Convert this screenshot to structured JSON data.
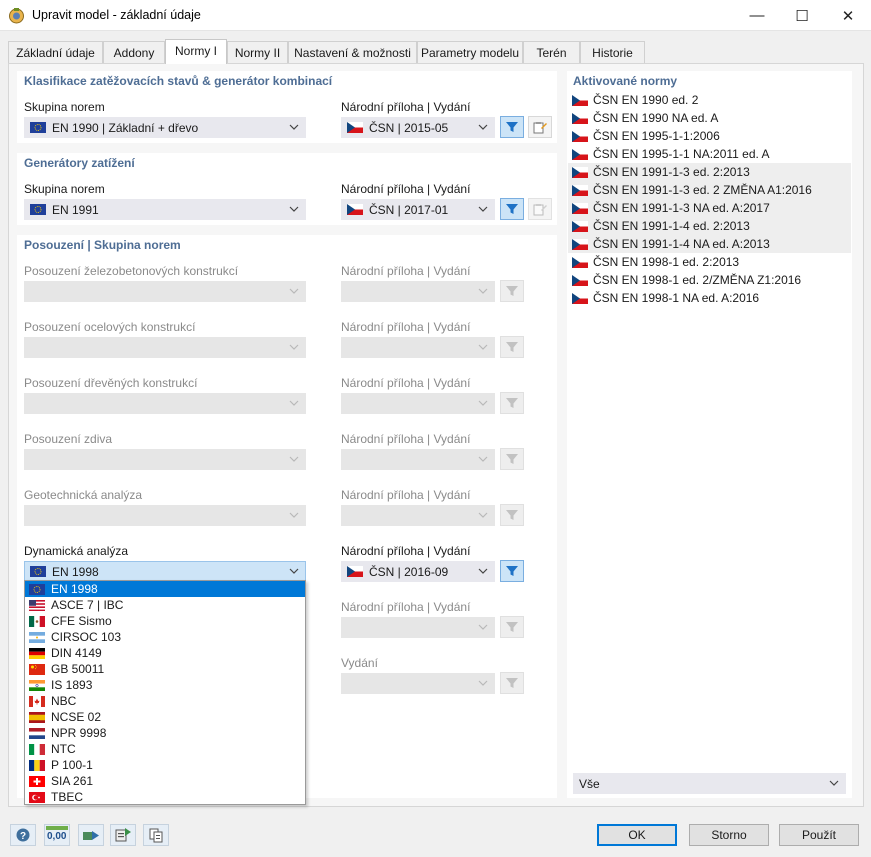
{
  "window": {
    "title": "Upravit model - základní údaje",
    "minimize_glyph": "—",
    "maximize_glyph": "☐",
    "close_glyph": "✕"
  },
  "tabs": [
    {
      "label": "Základní údaje",
      "active": false
    },
    {
      "label": "Addony",
      "active": false
    },
    {
      "label": "Normy I",
      "active": true
    },
    {
      "label": "Normy II",
      "active": false
    },
    {
      "label": "Nastavení & možnosti",
      "active": false
    },
    {
      "label": "Parametry modelu",
      "active": false
    },
    {
      "label": "Terén",
      "active": false
    },
    {
      "label": "Historie",
      "active": false
    }
  ],
  "classification": {
    "title": "Klasifikace zatěžovacích stavů & generátor kombinací",
    "group_label": "Skupina norem",
    "group_value": "EN 1990 | Základní + dřevo",
    "annex_label": "Národní příloha | Vydání",
    "annex_value": "ČSN | 2015-05"
  },
  "generators": {
    "title": "Generátory zatížení",
    "group_label": "Skupina norem",
    "group_value": "EN 1991",
    "annex_label": "Národní příloha | Vydání",
    "annex_value": "ČSN | 2017-01"
  },
  "design": {
    "title": "Posouzení | Skupina norem",
    "rows": [
      {
        "label": "Posouzení železobetonových konstrukcí",
        "annex_label": "Národní příloha | Vydání"
      },
      {
        "label": "Posouzení ocelových konstrukcí",
        "annex_label": "Národní příloha | Vydání"
      },
      {
        "label": "Posouzení dřevěných konstrukcí",
        "annex_label": "Národní příloha | Vydání"
      },
      {
        "label": "Posouzení zdiva",
        "annex_label": "Národní příloha | Vydání"
      },
      {
        "label": "Geotechnická analýza",
        "annex_label": "Národní příloha | Vydání"
      }
    ],
    "dynamic_label": "Dynamická analýza",
    "dynamic_value": "EN 1998",
    "dynamic_annex_label": "Národní příloha | Vydání",
    "dynamic_annex_value": "ČSN | 2016-09",
    "row7_annex_label": "Národní příloha | Vydání",
    "row8_annex_label": "Vydání"
  },
  "dropdown_options": [
    {
      "label": "EN 1998",
      "flag": "eu",
      "selected": true
    },
    {
      "label": "ASCE 7 | IBC",
      "flag": "us"
    },
    {
      "label": "CFE Sismo",
      "flag": "mx"
    },
    {
      "label": "CIRSOC 103",
      "flag": "ar"
    },
    {
      "label": "DIN 4149",
      "flag": "de"
    },
    {
      "label": "GB 50011",
      "flag": "cn"
    },
    {
      "label": "IS 1893",
      "flag": "in"
    },
    {
      "label": "NBC",
      "flag": "ca"
    },
    {
      "label": "NCSE 02",
      "flag": "es"
    },
    {
      "label": "NPR 9998",
      "flag": "nl"
    },
    {
      "label": "NTC",
      "flag": "it"
    },
    {
      "label": "P 100-1",
      "flag": "ro"
    },
    {
      "label": "SIA 261",
      "flag": "ch"
    },
    {
      "label": "TBEC",
      "flag": "tr"
    }
  ],
  "activated": {
    "title": "Aktivované normy",
    "items": [
      {
        "label": "ČSN EN 1990 ed. 2",
        "hl": false
      },
      {
        "label": "ČSN EN 1990 NA ed. A",
        "hl": false
      },
      {
        "label": "ČSN EN 1995-1-1:2006",
        "hl": false
      },
      {
        "label": "ČSN EN 1995-1-1 NA:2011 ed. A",
        "hl": false
      },
      {
        "label": "ČSN EN 1991-1-3 ed. 2:2013",
        "hl": true
      },
      {
        "label": "ČSN EN 1991-1-3 ed. 2 ZMĚNA A1:2016",
        "hl": true
      },
      {
        "label": "ČSN EN 1991-1-3 NA ed. A:2017",
        "hl": true
      },
      {
        "label": "ČSN EN 1991-1-4 ed. 2:2013",
        "hl": true
      },
      {
        "label": "ČSN EN 1991-1-4 NA ed. A:2013",
        "hl": true
      },
      {
        "label": "ČSN EN 1998-1 ed. 2:2013",
        "hl": false
      },
      {
        "label": "ČSN EN 1998-1 ed. 2/ZMĚNA Z1:2016",
        "hl": false
      },
      {
        "label": "ČSN EN 1998-1 NA ed. A:2016",
        "hl": false
      }
    ],
    "filter_value": "Vše"
  },
  "toolbar": {
    "units_text": "0,00"
  },
  "buttons": {
    "ok": "OK",
    "cancel": "Storno",
    "apply": "Použít"
  },
  "colors": {
    "accent": "#0078d7",
    "panel_title": "#4e6d94",
    "filter_blue": "#1e72c6"
  }
}
